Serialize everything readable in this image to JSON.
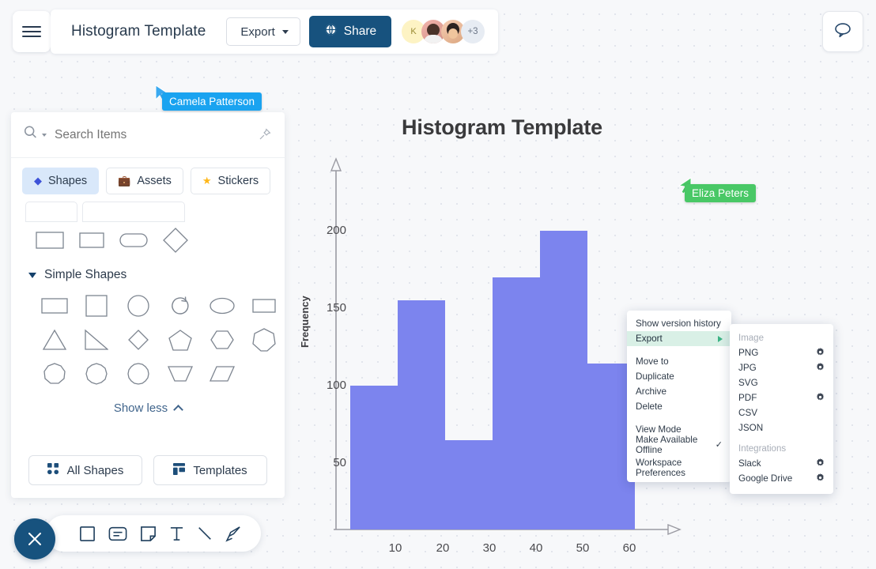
{
  "header": {
    "menu_icon": "hamburger-icon",
    "doc_title": "Histogram Template",
    "export_label": "Export",
    "share_label": "Share",
    "share_icon": "globe-icon",
    "comment_icon": "comment-bubble-icon",
    "avatars": [
      {
        "initial": "K",
        "name": "avatar-k"
      },
      {
        "initial": "",
        "name": "avatar-photo-1"
      },
      {
        "initial": "",
        "name": "avatar-photo-2"
      },
      {
        "initial": "+3",
        "name": "avatar-overflow"
      }
    ]
  },
  "sidebar": {
    "search": {
      "value": "",
      "placeholder": "Search Items",
      "icon": "search-icon",
      "pin_icon": "pin-icon"
    },
    "tabs": [
      {
        "label": "Shapes",
        "glyph": "◆",
        "active": true
      },
      {
        "label": "Assets",
        "glyph": "💼",
        "active": false
      },
      {
        "label": "Stickers",
        "glyph": "★",
        "active": false
      }
    ],
    "recent_shapes": [
      "rectangle",
      "rectangle",
      "rounded-rectangle",
      "diamond"
    ],
    "section": {
      "title": "Simple Shapes",
      "expanded": true
    },
    "simple_shapes": [
      "rectangle-wide",
      "square",
      "circle",
      "arc-arrow",
      "ellipse",
      "rectangle-wide",
      "triangle",
      "right-triangle",
      "diamond",
      "pentagon",
      "hexagon",
      "heptagon",
      "nonagon",
      "decagon",
      "dodecagon",
      "trapezoid-inverted",
      "parallelogram"
    ],
    "show_less_label": "Show less",
    "footer_buttons": [
      {
        "label": "All Shapes",
        "icon": "grid-dots-icon"
      },
      {
        "label": "Templates",
        "icon": "template-layout-icon"
      }
    ]
  },
  "bottom_toolbar": {
    "close_icon": "close-x-icon",
    "tools": [
      {
        "name": "shape-tool",
        "icon": "square-icon"
      },
      {
        "name": "card-tool",
        "icon": "card-icon"
      },
      {
        "name": "note-tool",
        "icon": "sticky-note-icon"
      },
      {
        "name": "text-tool",
        "icon": "text-t-icon"
      },
      {
        "name": "line-tool",
        "icon": "diagonal-line-icon"
      },
      {
        "name": "freehand-tool",
        "icon": "pen-nib-icon"
      }
    ]
  },
  "cursors": [
    {
      "name": "Camela Patterson",
      "color": "#1aa3f0"
    },
    {
      "name": "Eliza Peters",
      "color": "#49c866"
    }
  ],
  "context_menu": {
    "items": [
      {
        "label": "Show version history",
        "highlighted": false,
        "submenu": false,
        "check": false
      },
      {
        "label": "Export",
        "highlighted": true,
        "submenu": true,
        "check": false
      },
      {
        "gap": true
      },
      {
        "label": "Move to",
        "highlighted": false,
        "submenu": false,
        "check": false
      },
      {
        "label": "Duplicate",
        "highlighted": false,
        "submenu": false,
        "check": false
      },
      {
        "label": "Archive",
        "highlighted": false,
        "submenu": false,
        "check": false
      },
      {
        "label": "Delete",
        "highlighted": false,
        "submenu": false,
        "check": false
      },
      {
        "gap": true
      },
      {
        "label": "View Mode",
        "highlighted": false,
        "submenu": false,
        "check": false
      },
      {
        "label": "Make Available Offline",
        "highlighted": false,
        "submenu": false,
        "check": true
      },
      {
        "gap": true
      },
      {
        "label": "Workspace Preferences",
        "highlighted": false,
        "submenu": false,
        "check": false
      }
    ],
    "highlight_color": "#d9f0e6"
  },
  "export_submenu": {
    "groups": [
      {
        "heading": "Image",
        "items": [
          {
            "label": "PNG",
            "gear": true
          },
          {
            "label": "JPG",
            "gear": true
          },
          {
            "label": "SVG",
            "gear": false
          },
          {
            "label": "PDF",
            "gear": true
          },
          {
            "label": "CSV",
            "gear": false
          },
          {
            "label": "JSON",
            "gear": false
          }
        ]
      },
      {
        "heading": "Integrations",
        "items": [
          {
            "label": "Slack",
            "gear": true
          },
          {
            "label": "Google Drive",
            "gear": true
          }
        ]
      }
    ]
  },
  "chart_data": {
    "type": "bar",
    "title": "Histogram Template",
    "xlabel": "",
    "ylabel": "Frequency",
    "categories": [
      "10",
      "20",
      "30",
      "40",
      "50",
      "60"
    ],
    "values": [
      100,
      155,
      65,
      168,
      200,
      114
    ],
    "ylim": [
      0,
      230
    ],
    "yticks": [
      50,
      100,
      150,
      200
    ],
    "xticks": [
      "10",
      "20",
      "30",
      "40",
      "50",
      "60"
    ],
    "bar_color": "#7c84ee",
    "grid": false,
    "legend": false
  }
}
